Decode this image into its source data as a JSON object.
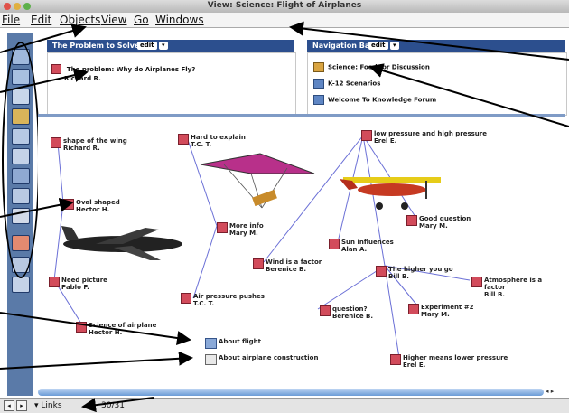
{
  "window": {
    "title": "View: Science: Flight of Airplanes"
  },
  "menubar": {
    "items": [
      "File",
      "Edit",
      "Objects",
      "View",
      "Go",
      "Windows"
    ]
  },
  "problem_pane": {
    "title": "The Problem to Solve",
    "edit_label": "edit",
    "items": [
      {
        "text": "The problem: Why do Airplanes Fly?",
        "author": "Richard R."
      }
    ]
  },
  "nav_pane": {
    "title": "Navigation Bar",
    "edit_label": "edit",
    "items": [
      "Science: Food for Discussion",
      "K-12 Scenarios",
      "Welcome To Knowledge Forum"
    ]
  },
  "notes": [
    {
      "title": "shape of the wing",
      "author": "Richard R."
    },
    {
      "title": "Hard to explain",
      "author": "T.C. T."
    },
    {
      "title": "low pressure and high pressure",
      "author": "Erel E."
    },
    {
      "title": "Oval shaped",
      "author": "Hector H."
    },
    {
      "title": "Good question",
      "author": "Mary M."
    },
    {
      "title": "More info",
      "author": "Mary M."
    },
    {
      "title": "Sun influences",
      "author": "Alan A."
    },
    {
      "title": "Wind is a factor",
      "author": "Berenice B."
    },
    {
      "title": "The higher you go",
      "author": "Bill B."
    },
    {
      "title": "Atmosphere is a factor",
      "author": "Bill B."
    },
    {
      "title": "Need picture",
      "author": "Pablo P."
    },
    {
      "title": "Air pressure pushes",
      "author": "T.C. T."
    },
    {
      "title": "question?",
      "author": "Berenice B."
    },
    {
      "title": "Experiment #2",
      "author": "Mary M."
    },
    {
      "title": "Science of airplane",
      "author": "Hector H."
    },
    {
      "title": "Higher means lower pressure",
      "author": "Erel E."
    }
  ],
  "links": [
    "About flight",
    "About airplane construction"
  ],
  "bottom": {
    "links_label": "Links",
    "count": "30/31"
  },
  "colors": {
    "header": "#2c4f8e",
    "toolbar": "#5a7aa8",
    "note": "#d24b5b"
  }
}
